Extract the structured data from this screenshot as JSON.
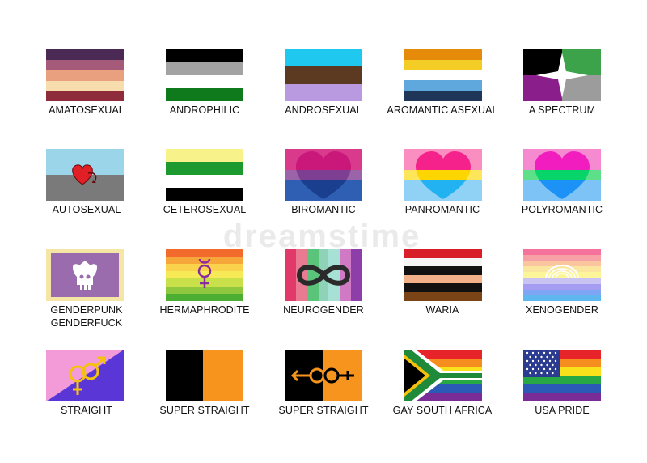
{
  "watermark": "dreamstime",
  "flags": [
    {
      "label": "AMATOSEXUAL"
    },
    {
      "label": "ANDROPHILIC"
    },
    {
      "label": "ANDROSEXUAL"
    },
    {
      "label": "AROMANTIC ASEXUAL"
    },
    {
      "label": "A SPECTRUM"
    },
    {
      "label": "AUTOSEXUAL"
    },
    {
      "label": "CETEROSEXUAL"
    },
    {
      "label": "BIROMANTIC"
    },
    {
      "label": "PANROMANTIC"
    },
    {
      "label": "POLYROMANTIC"
    },
    {
      "label": "GENDERPUNK GENDERFUCK"
    },
    {
      "label": "HERMAPHRODITE"
    },
    {
      "label": "NEUROGENDER"
    },
    {
      "label": "WARIA"
    },
    {
      "label": "XENOGENDER"
    },
    {
      "label": "STRAIGHT"
    },
    {
      "label": "SUPER STRAIGHT"
    },
    {
      "label": "SUPER STRAIGHT"
    },
    {
      "label": "GAY SOUTH AFRICA"
    },
    {
      "label": "USA PRIDE"
    }
  ]
}
